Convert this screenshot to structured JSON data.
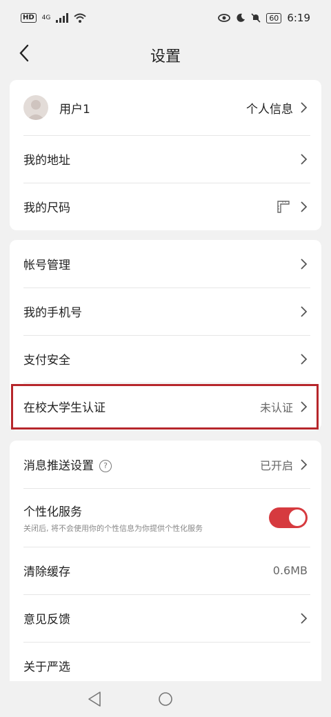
{
  "status": {
    "hd": "HD",
    "network": "4G",
    "battery": "60",
    "time": "6:19"
  },
  "header": {
    "title": "设置"
  },
  "profile": {
    "username": "用户1",
    "action": "个人信息"
  },
  "group1": {
    "address": "我的地址",
    "size": "我的尺码"
  },
  "group2": {
    "account": "帐号管理",
    "phone": "我的手机号",
    "payment": "支付安全",
    "student": "在校大学生认证",
    "student_status": "未认证"
  },
  "group3": {
    "push": "消息推送设置",
    "push_help": "?",
    "push_status": "已开启",
    "personal": "个性化服务",
    "personal_desc": "关闭后, 将不会使用你的个性信息为你提供个性化服务",
    "cache": "清除缓存",
    "cache_size": "0.6MB",
    "feedback": "意见反馈",
    "about": "关于严选"
  },
  "colors": {
    "accent": "#d63a3f",
    "highlight_border": "#b6262b"
  }
}
